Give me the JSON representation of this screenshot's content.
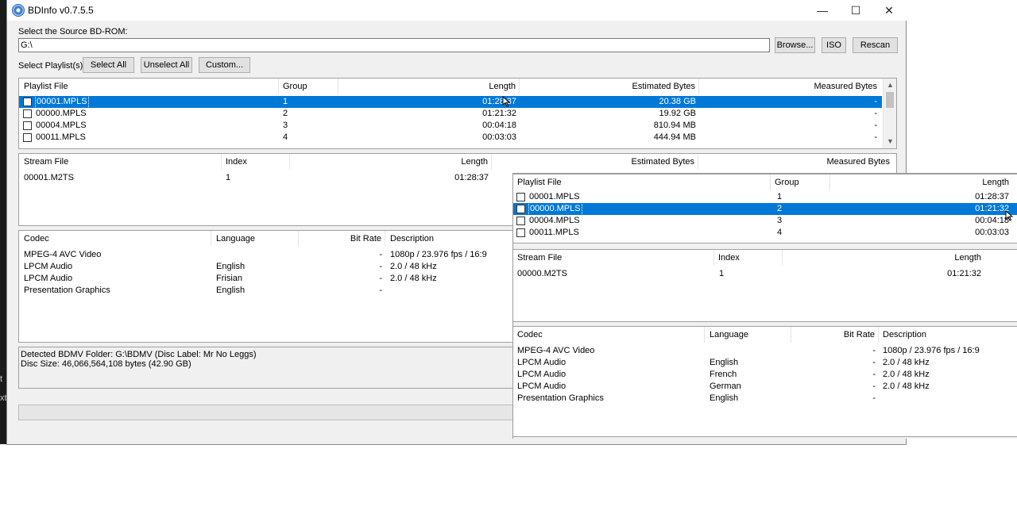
{
  "edge": {
    "labels": [
      "t",
      "xt"
    ]
  },
  "window": {
    "title": "BDInfo v0.7.5.5",
    "controls": {
      "minimize": "—",
      "maximize": "☐",
      "close": "✕"
    }
  },
  "source": {
    "label": "Select the Source BD-ROM:",
    "path": "G:\\",
    "browse": "Browse...",
    "iso": "ISO",
    "rescan": "Rescan"
  },
  "playlist_select": {
    "label": "Select Playlist(s):",
    "select_all": "Select All",
    "unselect_all": "Unselect All",
    "custom": "Custom..."
  },
  "playlists": {
    "headers": [
      "Playlist File",
      "Group",
      "Length",
      "Estimated Bytes",
      "Measured Bytes"
    ],
    "rows": [
      {
        "file": "00001.MPLS",
        "group": "1",
        "length": "01:28:37",
        "est": "20.38 GB",
        "meas": "-"
      },
      {
        "file": "00000.MPLS",
        "group": "2",
        "length": "01:21:32",
        "est": "19.92 GB",
        "meas": "-"
      },
      {
        "file": "00004.MPLS",
        "group": "3",
        "length": "00:04:18",
        "est": "810.94 MB",
        "meas": "-"
      },
      {
        "file": "00011.MPLS",
        "group": "4",
        "length": "00:03:03",
        "est": "444.94 MB",
        "meas": "-"
      }
    ]
  },
  "streams": {
    "headers": [
      "Stream File",
      "Index",
      "Length",
      "Estimated Bytes",
      "Measured Bytes"
    ],
    "rows": [
      {
        "file": "00001.M2TS",
        "index": "1",
        "length": "01:28:37"
      }
    ]
  },
  "codecs": {
    "headers": [
      "Codec",
      "Language",
      "Bit Rate",
      "Description"
    ],
    "rows": [
      {
        "codec": "MPEG-4 AVC Video",
        "language": "",
        "bitrate": "-",
        "desc": "1080p / 23.976 fps / 16:9"
      },
      {
        "codec": "LPCM Audio",
        "language": "English",
        "bitrate": "-",
        "desc": "2.0 / 48 kHz"
      },
      {
        "codec": "LPCM Audio",
        "language": "Frisian",
        "bitrate": "-",
        "desc": "2.0 / 48 kHz"
      },
      {
        "codec": "Presentation Graphics",
        "language": "English",
        "bitrate": "-",
        "desc": ""
      }
    ]
  },
  "status": {
    "line1": "Detected BDMV Folder: G:\\BDMV (Disc Label: Mr No Leggs)",
    "line2": "Disc Size: 46,066,564,108 bytes (42.90 GB)"
  },
  "overlay": {
    "playlists": {
      "headers": [
        "Playlist File",
        "Group",
        "Length"
      ],
      "rows": [
        {
          "file": "00001.MPLS",
          "group": "1",
          "length": "01:28:37"
        },
        {
          "file": "00000.MPLS",
          "group": "2",
          "length": "01:21:32"
        },
        {
          "file": "00004.MPLS",
          "group": "3",
          "length": "00:04:18"
        },
        {
          "file": "00011.MPLS",
          "group": "4",
          "length": "00:03:03"
        }
      ]
    },
    "streams": {
      "headers": [
        "Stream File",
        "Index",
        "Length"
      ],
      "rows": [
        {
          "file": "00000.M2TS",
          "index": "1",
          "length": "01:21:32"
        }
      ]
    },
    "codecs": {
      "headers": [
        "Codec",
        "Language",
        "Bit Rate",
        "Description"
      ],
      "rows": [
        {
          "codec": "MPEG-4 AVC Video",
          "language": "",
          "bitrate": "-",
          "desc": "1080p / 23.976 fps / 16:9"
        },
        {
          "codec": "LPCM Audio",
          "language": "English",
          "bitrate": "-",
          "desc": "2.0 / 48 kHz"
        },
        {
          "codec": "LPCM Audio",
          "language": "French",
          "bitrate": "-",
          "desc": "2.0 / 48 kHz"
        },
        {
          "codec": "LPCM Audio",
          "language": "German",
          "bitrate": "-",
          "desc": "2.0 / 48 kHz"
        },
        {
          "codec": "Presentation Graphics",
          "language": "English",
          "bitrate": "-",
          "desc": ""
        }
      ]
    }
  }
}
